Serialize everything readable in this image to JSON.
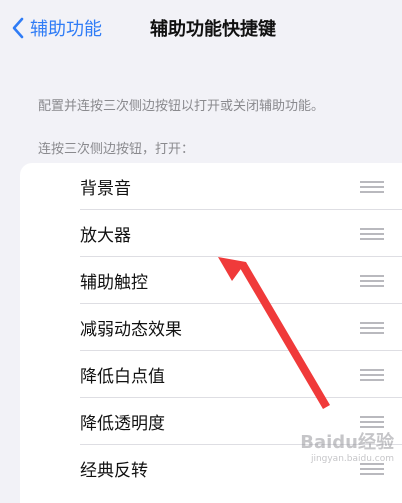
{
  "nav": {
    "back_label": "辅助功能",
    "title": "辅助功能快捷键"
  },
  "description": "配置并连按三次侧边按钮以打开或关闭辅助功能。",
  "section_header": "连按三次侧边按钮，打开：",
  "items": [
    {
      "label": "背景音"
    },
    {
      "label": "放大器"
    },
    {
      "label": "辅助触控"
    },
    {
      "label": "减弱动态效果"
    },
    {
      "label": "降低白点值"
    },
    {
      "label": "降低透明度"
    },
    {
      "label": "经典反转"
    }
  ],
  "watermark": {
    "text": "Baidu经验",
    "sub": "jingyan.baidu.com"
  },
  "colors": {
    "accent": "#2f7cf6",
    "annotation_arrow": "#f03a3a",
    "background": "#f2f2f7"
  }
}
